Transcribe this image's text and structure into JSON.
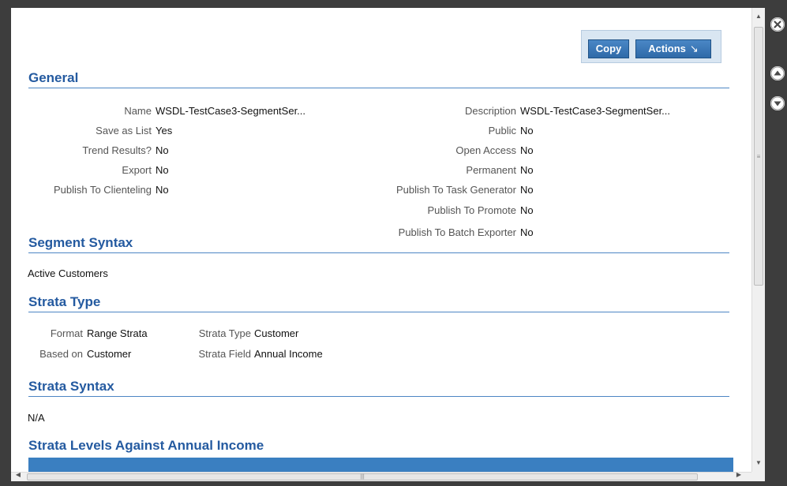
{
  "toolbar": {
    "copy_label": "Copy",
    "actions_label": "Actions",
    "actions_arrow": "↘"
  },
  "general": {
    "title": "General",
    "left": [
      {
        "label": "Name",
        "value": "WSDL-TestCase3-SegmentSer..."
      },
      {
        "label": "Save as List",
        "value": "Yes"
      },
      {
        "label": "Trend Results?",
        "value": "No"
      },
      {
        "label": "Export",
        "value": "No"
      },
      {
        "label": "Publish To Clienteling",
        "value": "No"
      }
    ],
    "right": [
      {
        "label": "Description",
        "value": "WSDL-TestCase3-SegmentSer..."
      },
      {
        "label": "Public",
        "value": "No"
      },
      {
        "label": "Open Access",
        "value": "No"
      },
      {
        "label": "Permanent",
        "value": "No"
      },
      {
        "label": "Publish To Task Generator",
        "value": "No"
      },
      {
        "label": "Publish To Promote",
        "value": "No"
      },
      {
        "label": "Publish To Batch Exporter",
        "value": "No"
      }
    ]
  },
  "segment_syntax": {
    "title": "Segment Syntax",
    "value": "Active Customers"
  },
  "strata_type": {
    "title": "Strata Type",
    "format_label": "Format",
    "format_value": "Range Strata",
    "based_on_label": "Based on",
    "based_on_value": "Customer",
    "strata_type_label": "Strata Type",
    "strata_type_value": "Customer",
    "strata_field_label": "Strata Field",
    "strata_field_value": "Annual Income"
  },
  "strata_syntax": {
    "title": "Strata Syntax",
    "value": "N/A"
  },
  "strata_levels": {
    "title": "Strata Levels Against Annual Income"
  },
  "icons": [
    "close-icon",
    "scroll-up-icon",
    "scroll-down-icon"
  ],
  "colors": {
    "accent": "#245aa0",
    "button": "#2f6aa8",
    "table_header": "#3a7fc1"
  }
}
